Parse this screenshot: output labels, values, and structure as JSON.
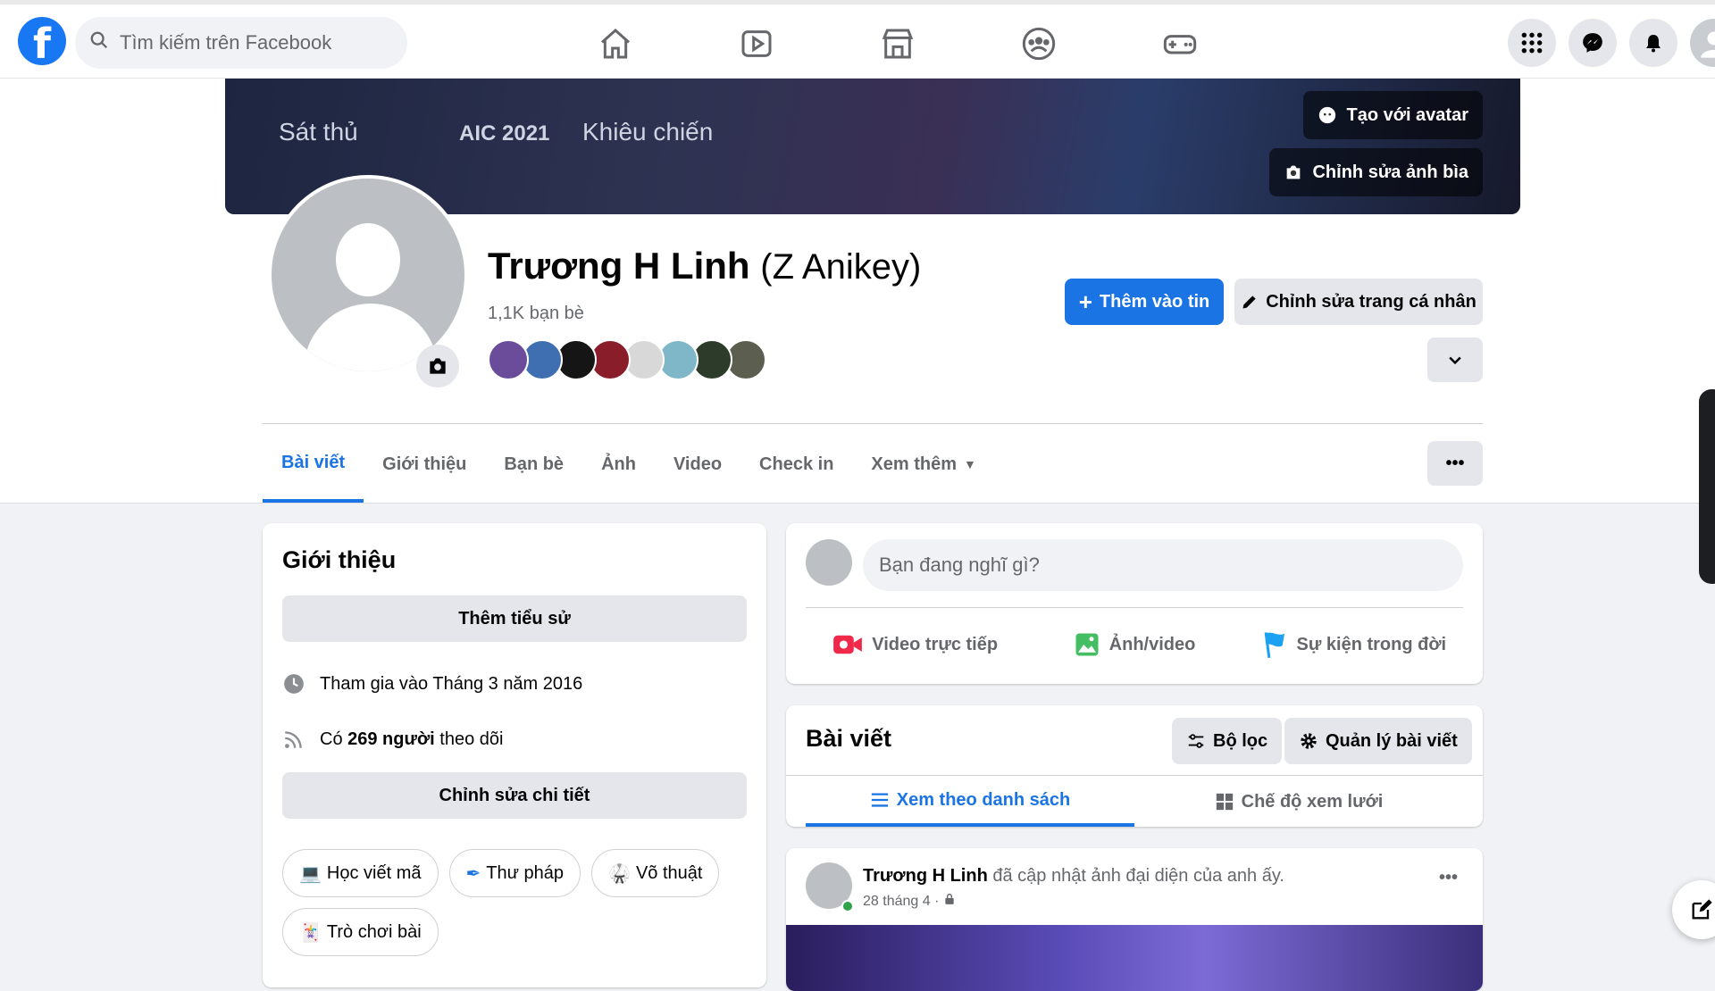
{
  "topbar": {
    "logo": "f",
    "search_placeholder": "Tìm kiếm trên Facebook"
  },
  "cover": {
    "tag_role": "Sát thủ",
    "tag_event": "AIC 2021",
    "tag_skin": "Khiêu chiến",
    "btn_avatar": "Tạo với avatar",
    "btn_edit_cover": "Chỉnh sửa ảnh bìa"
  },
  "profile": {
    "name": "Trương H Linh",
    "alt_name": "(Z Anikey)",
    "friends": "1,1K bạn bè",
    "friend_colors": [
      "#6b4c9a",
      "#3f6fb0",
      "#151515",
      "#8a1d2a",
      "#d8d8d8",
      "#7fb7c9",
      "#2d3b2a",
      "#5c5e4f"
    ],
    "btn_add_story": "Thêm vào tin",
    "btn_edit_profile": "Chỉnh sửa trang cá nhân"
  },
  "tabs": [
    "Bài viết",
    "Giới thiệu",
    "Bạn bè",
    "Ảnh",
    "Video",
    "Check in",
    "Xem thêm"
  ],
  "intro": {
    "title": "Giới thiệu",
    "btn_bio": "Thêm tiểu sử",
    "joined": "Tham gia vào Tháng 3 năm 2016",
    "followers_prefix": "Có ",
    "followers_count": "269 người",
    "followers_suffix": " theo dõi",
    "btn_edit_details": "Chỉnh sửa chi tiết",
    "hobbies": [
      {
        "icon": "💻",
        "label": "Học viết mã"
      },
      {
        "icon": "✒",
        "label": "Thư pháp"
      },
      {
        "icon": "🥋",
        "label": "Võ thuật"
      },
      {
        "icon": "🃏",
        "label": "Trò chơi bài"
      }
    ]
  },
  "composer": {
    "placeholder": "Bạn đang nghĩ gì?",
    "live": "Video trực tiếp",
    "photo": "Ảnh/video",
    "event": "Sự kiện trong đời"
  },
  "posts": {
    "title": "Bài viết",
    "filter": "Bộ lọc",
    "manage": "Quản lý bài viết",
    "list_view": "Xem theo danh sách",
    "grid_view": "Chế độ xem lưới"
  },
  "post": {
    "author": "Trương H Linh",
    "action": " đã cập nhật ảnh đại diện của anh ấy.",
    "date": "28 tháng 4 ·",
    "more": "•••"
  },
  "colors": {
    "accent": "#1b74e4",
    "live": "#f02849",
    "photo": "#45bd62",
    "event": "#1da1f2"
  }
}
